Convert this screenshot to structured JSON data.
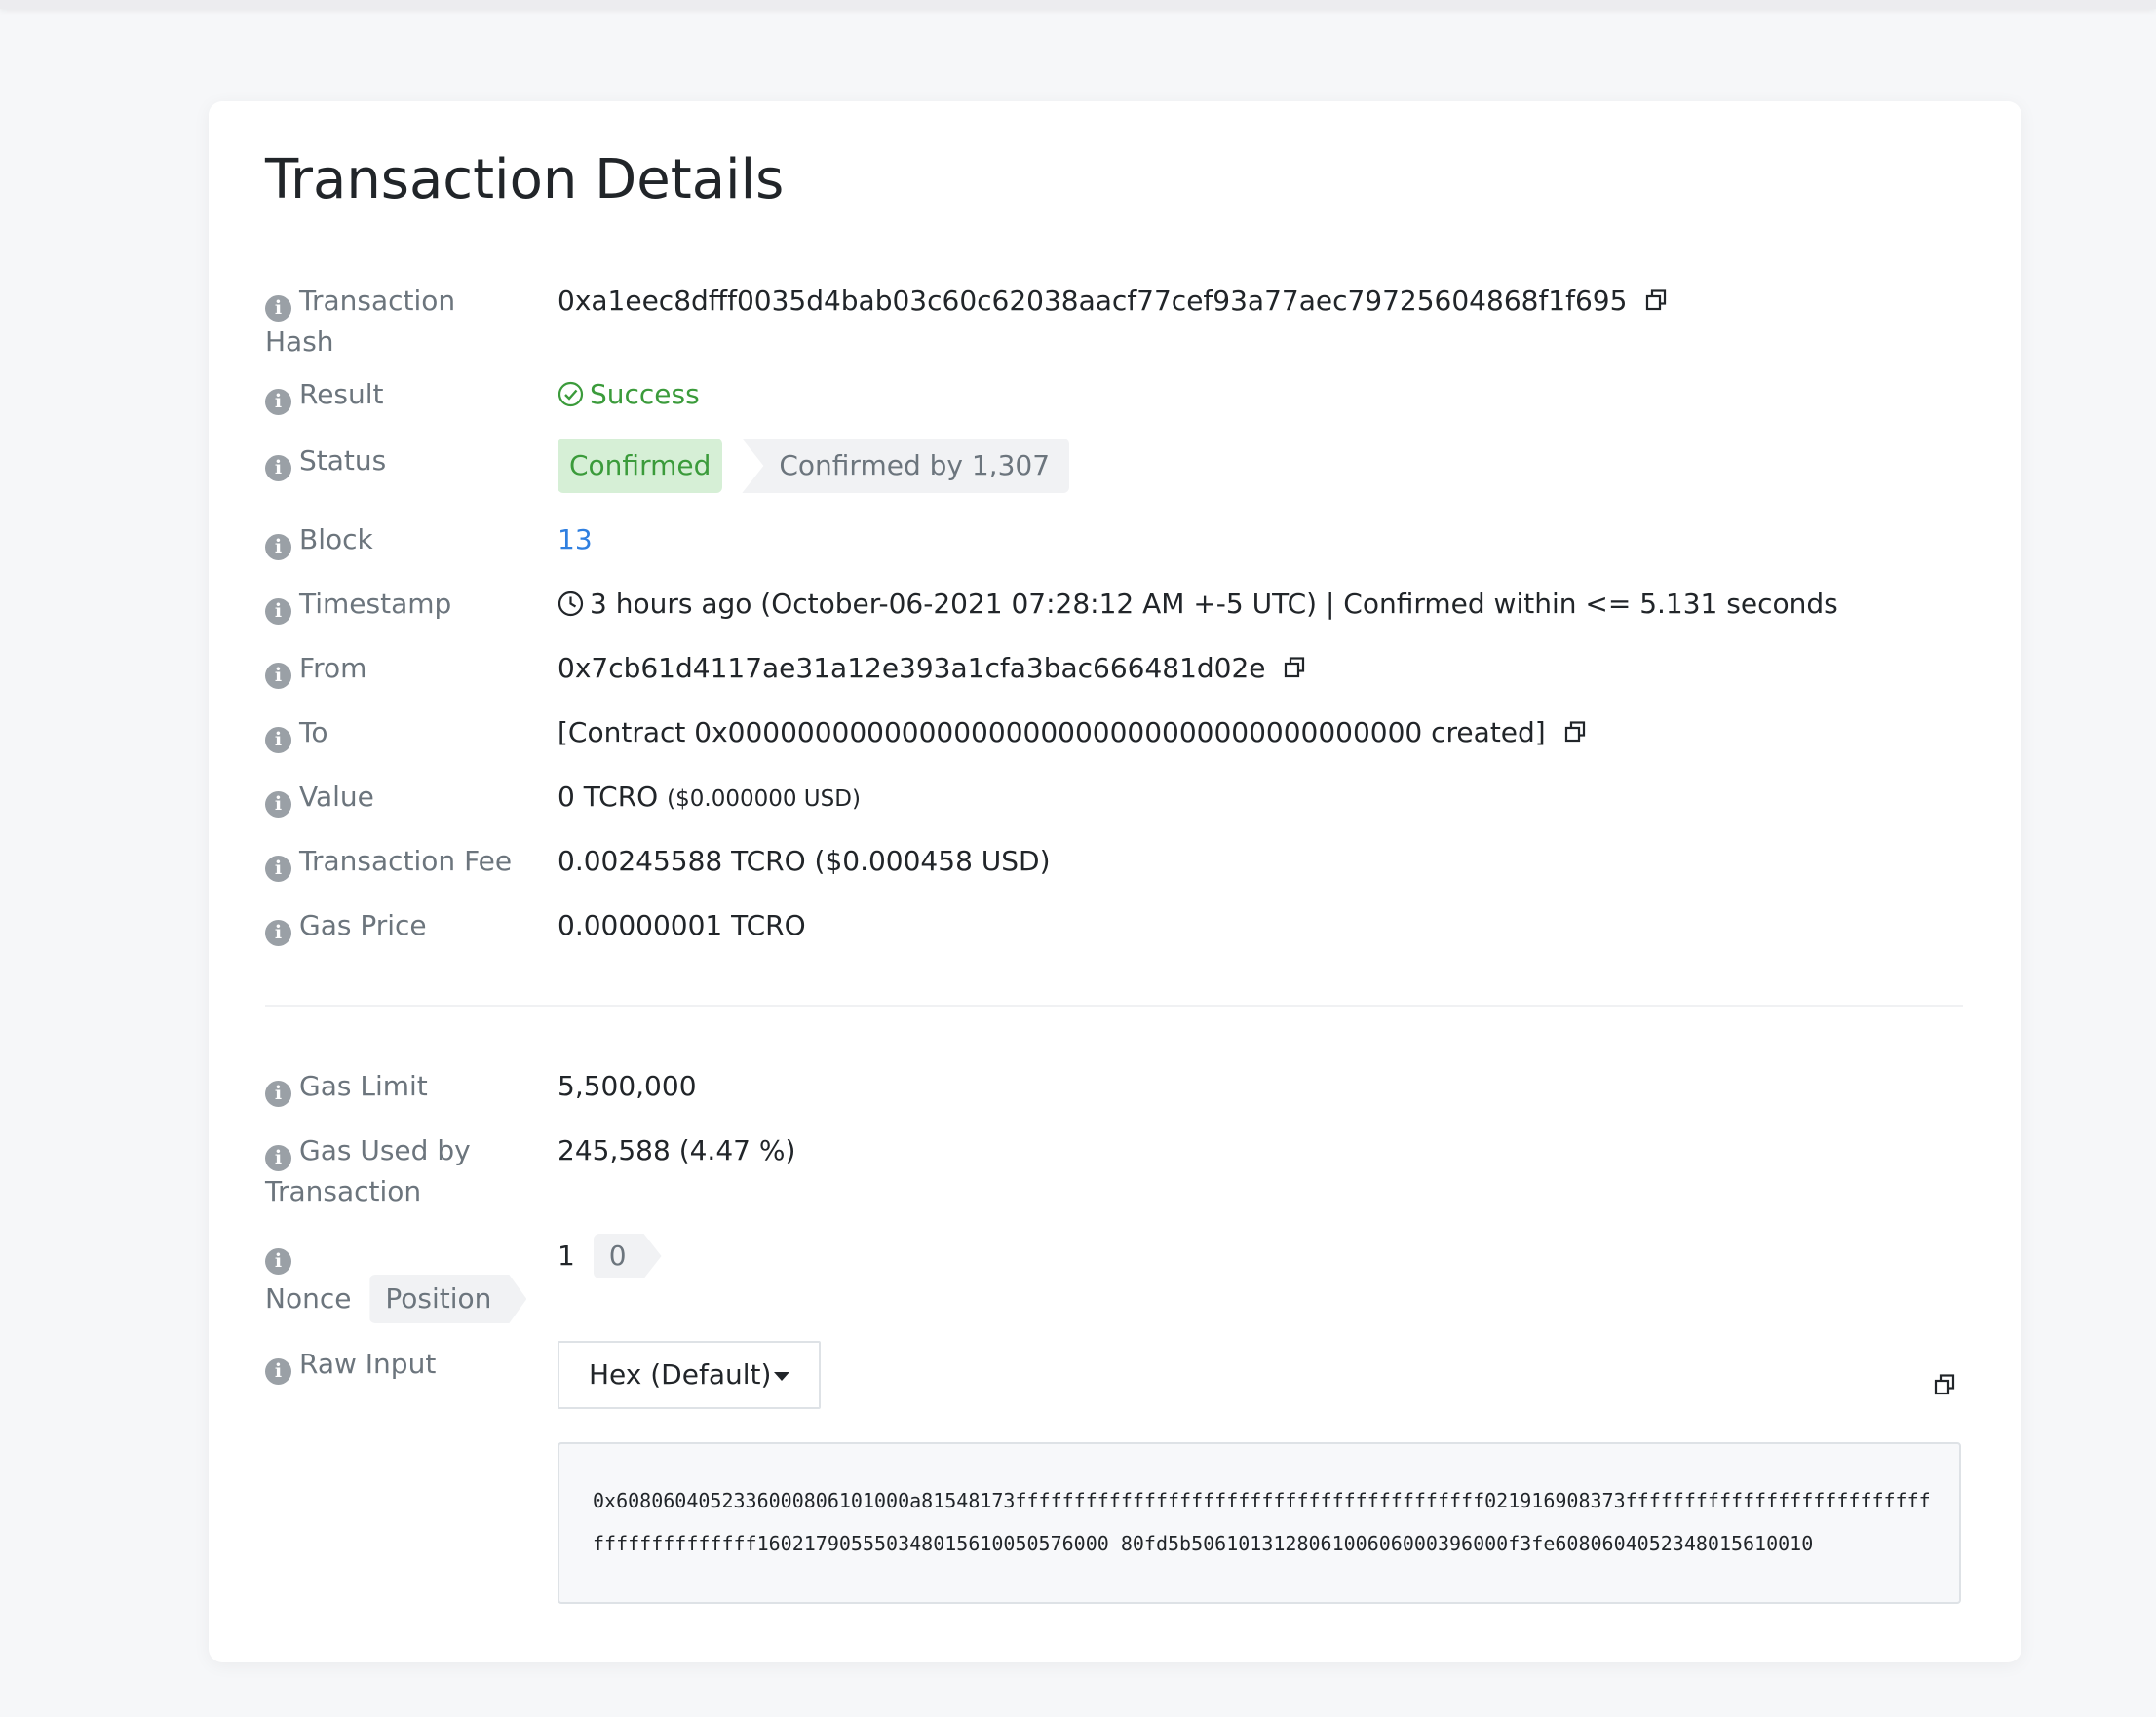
{
  "page": {
    "title": "Transaction Details"
  },
  "rows": {
    "tx_hash": {
      "label_line1": "Transaction",
      "label_line2": "Hash",
      "value": "0xa1eec8dfff0035d4bab03c60c62038aacf77cef93a77aec79725604868f1f695"
    },
    "result": {
      "label": "Result",
      "value": "Success"
    },
    "status": {
      "label": "Status",
      "badge": "Confirmed",
      "confirmations": "Confirmed by 1,307"
    },
    "block": {
      "label": "Block",
      "value": "13"
    },
    "timestamp": {
      "label": "Timestamp",
      "value": "3 hours ago (October-06-2021 07:28:12 AM +-5 UTC) | Confirmed within <= 5.131 seconds"
    },
    "from": {
      "label": "From",
      "value": "0x7cb61d4117ae31a12e393a1cfa3bac666481d02e"
    },
    "to": {
      "label": "To",
      "value": "[Contract 0x0000000000000000000000000000000000000000 created]"
    },
    "value": {
      "label": "Value",
      "amount": "0 TCRO",
      "usd": "($0.000000 USD)"
    },
    "fee": {
      "label": "Transaction Fee",
      "value": "0.00245588 TCRO ($0.000458 USD)"
    },
    "gas_price": {
      "label": "Gas Price",
      "value": "0.00000001 TCRO"
    },
    "gas_limit": {
      "label": "Gas Limit",
      "value": "5,500,000"
    },
    "gas_used": {
      "label_line1": "Gas Used by",
      "label_line2": "Transaction",
      "value": "245,588 (4.47 %)"
    },
    "nonce": {
      "label": "Nonce",
      "position_tag": "Position",
      "nonce_value": "1",
      "position_value": "0"
    },
    "raw_input": {
      "label": "Raw Input",
      "format_selected": "Hex (Default)",
      "data": "0x6080604052336000806101000a81548173ffffffffffffffffffffffffffffffffffffffff021916908373ffffffffffffffffffffffffffffffffffffffff160217905550348015610050576000 80fd5b506101312806100606000396000f3fe6080604052348015610010"
    }
  },
  "colors": {
    "success": "#3b9b3b",
    "link": "#2f7fe0",
    "badge_bg": "#d6efd6",
    "muted": "#6c757d"
  },
  "icons": {
    "info": "info-circle-icon",
    "copy": "copy-icon",
    "check": "check-circle-icon",
    "clock": "clock-icon",
    "caret": "caret-down-icon"
  }
}
